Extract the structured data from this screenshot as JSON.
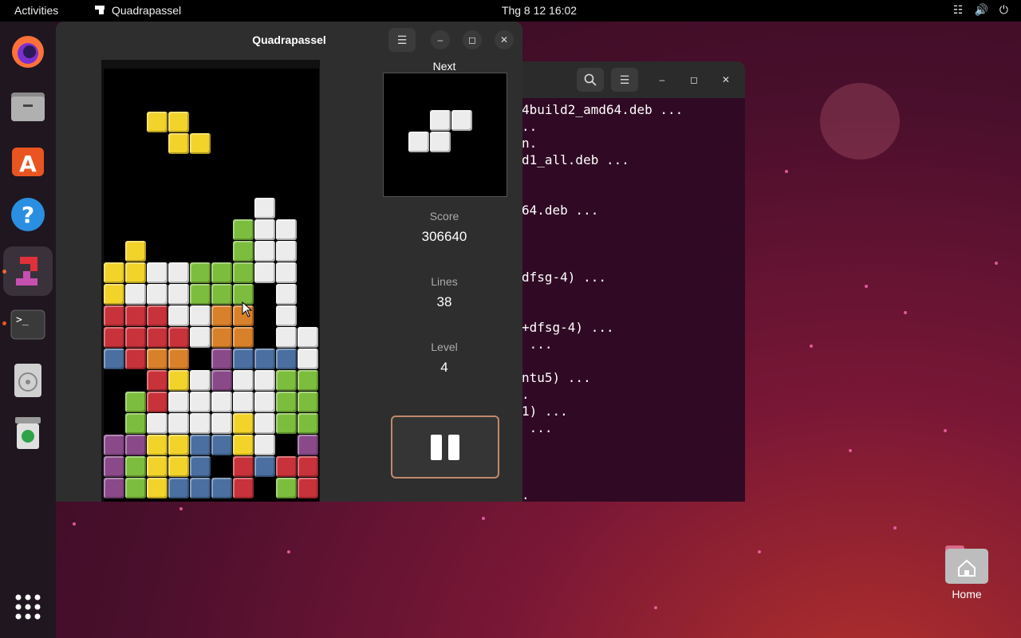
{
  "topbar": {
    "activities": "Activities",
    "app_name": "Quadrapassel",
    "clock": "Thg 8 12  16:02"
  },
  "game_window": {
    "title": "Quadrapassel",
    "next_label": "Next",
    "score_label": "Score",
    "score": "306640",
    "lines_label": "Lines",
    "lines": "38",
    "level_label": "Level",
    "level": "4"
  },
  "terminal": {
    "lines": [
      "4build2_amd64.deb ...",
      "..",
      "n.",
      "d1_all.deb ...",
      "",
      "",
      "64.deb ...",
      "",
      "",
      "",
      "dfsg-4) ...",
      "",
      "",
      "+dfsg-4) ...",
      " ...",
      "",
      "ntu5) ...",
      ".",
      "1) ...",
      " ...",
      "",
      "",
      "",
      "."
    ]
  },
  "desktop": {
    "home_label": "Home"
  },
  "colors": {
    "yellow": "#f2d32a",
    "white": "#ececec",
    "green": "#7dbd3e",
    "red": "#c8323a",
    "orange": "#d9812a",
    "blue": "#4a6fa0",
    "purple": "#8a4a8a"
  },
  "board": {
    "falling": [
      [
        2,
        2,
        "yellow"
      ],
      [
        3,
        2,
        "yellow"
      ],
      [
        3,
        3,
        "yellow"
      ],
      [
        4,
        3,
        "yellow"
      ]
    ],
    "next": [
      [
        1,
        0,
        "white"
      ],
      [
        2,
        0,
        "white"
      ],
      [
        0,
        1,
        "white"
      ],
      [
        1,
        1,
        "white"
      ]
    ],
    "cells": [
      [
        7,
        6,
        "white"
      ],
      [
        6,
        7,
        "green"
      ],
      [
        7,
        7,
        "white"
      ],
      [
        8,
        7,
        "white"
      ],
      [
        1,
        8,
        "yellow"
      ],
      [
        6,
        8,
        "green"
      ],
      [
        7,
        8,
        "white"
      ],
      [
        8,
        8,
        "white"
      ],
      [
        0,
        9,
        "yellow"
      ],
      [
        1,
        9,
        "yellow"
      ],
      [
        2,
        9,
        "white"
      ],
      [
        3,
        9,
        "white"
      ],
      [
        4,
        9,
        "green"
      ],
      [
        5,
        9,
        "green"
      ],
      [
        6,
        9,
        "green"
      ],
      [
        7,
        9,
        "white"
      ],
      [
        8,
        9,
        "white"
      ],
      [
        0,
        10,
        "yellow"
      ],
      [
        1,
        10,
        "white"
      ],
      [
        2,
        10,
        "white"
      ],
      [
        3,
        10,
        "white"
      ],
      [
        4,
        10,
        "green"
      ],
      [
        5,
        10,
        "green"
      ],
      [
        6,
        10,
        "green"
      ],
      [
        8,
        10,
        "white"
      ],
      [
        0,
        11,
        "red"
      ],
      [
        1,
        11,
        "red"
      ],
      [
        2,
        11,
        "red"
      ],
      [
        3,
        11,
        "white"
      ],
      [
        4,
        11,
        "white"
      ],
      [
        5,
        11,
        "orange"
      ],
      [
        6,
        11,
        "orange"
      ],
      [
        8,
        11,
        "white"
      ],
      [
        0,
        12,
        "red"
      ],
      [
        1,
        12,
        "red"
      ],
      [
        2,
        12,
        "red"
      ],
      [
        3,
        12,
        "red"
      ],
      [
        4,
        12,
        "white"
      ],
      [
        5,
        12,
        "orange"
      ],
      [
        6,
        12,
        "orange"
      ],
      [
        8,
        12,
        "white"
      ],
      [
        9,
        12,
        "white"
      ],
      [
        0,
        13,
        "blue"
      ],
      [
        1,
        13,
        "red"
      ],
      [
        2,
        13,
        "orange"
      ],
      [
        3,
        13,
        "orange"
      ],
      [
        5,
        13,
        "purple"
      ],
      [
        6,
        13,
        "blue"
      ],
      [
        7,
        13,
        "blue"
      ],
      [
        8,
        13,
        "blue"
      ],
      [
        9,
        13,
        "white"
      ],
      [
        2,
        14,
        "red"
      ],
      [
        3,
        14,
        "yellow"
      ],
      [
        4,
        14,
        "white"
      ],
      [
        5,
        14,
        "purple"
      ],
      [
        6,
        14,
        "white"
      ],
      [
        7,
        14,
        "white"
      ],
      [
        8,
        14,
        "green"
      ],
      [
        9,
        14,
        "green"
      ],
      [
        1,
        15,
        "green"
      ],
      [
        2,
        15,
        "red"
      ],
      [
        3,
        15,
        "white"
      ],
      [
        4,
        15,
        "white"
      ],
      [
        5,
        15,
        "white"
      ],
      [
        6,
        15,
        "white"
      ],
      [
        7,
        15,
        "white"
      ],
      [
        8,
        15,
        "green"
      ],
      [
        9,
        15,
        "green"
      ],
      [
        1,
        16,
        "green"
      ],
      [
        2,
        16,
        "white"
      ],
      [
        3,
        16,
        "white"
      ],
      [
        4,
        16,
        "white"
      ],
      [
        5,
        16,
        "white"
      ],
      [
        6,
        16,
        "yellow"
      ],
      [
        7,
        16,
        "white"
      ],
      [
        8,
        16,
        "green"
      ],
      [
        9,
        16,
        "green"
      ],
      [
        0,
        17,
        "purple"
      ],
      [
        1,
        17,
        "purple"
      ],
      [
        2,
        17,
        "yellow"
      ],
      [
        3,
        17,
        "yellow"
      ],
      [
        4,
        17,
        "blue"
      ],
      [
        5,
        17,
        "blue"
      ],
      [
        6,
        17,
        "yellow"
      ],
      [
        7,
        17,
        "white"
      ],
      [
        9,
        17,
        "purple"
      ],
      [
        0,
        18,
        "purple"
      ],
      [
        1,
        18,
        "green"
      ],
      [
        2,
        18,
        "yellow"
      ],
      [
        3,
        18,
        "yellow"
      ],
      [
        4,
        18,
        "blue"
      ],
      [
        6,
        18,
        "red"
      ],
      [
        7,
        18,
        "blue"
      ],
      [
        8,
        18,
        "red"
      ],
      [
        9,
        18,
        "red"
      ],
      [
        0,
        19,
        "purple"
      ],
      [
        1,
        19,
        "green"
      ],
      [
        2,
        19,
        "yellow"
      ],
      [
        3,
        19,
        "blue"
      ],
      [
        4,
        19,
        "blue"
      ],
      [
        5,
        19,
        "blue"
      ],
      [
        6,
        19,
        "red"
      ],
      [
        8,
        19,
        "green"
      ],
      [
        9,
        19,
        "red"
      ]
    ]
  }
}
